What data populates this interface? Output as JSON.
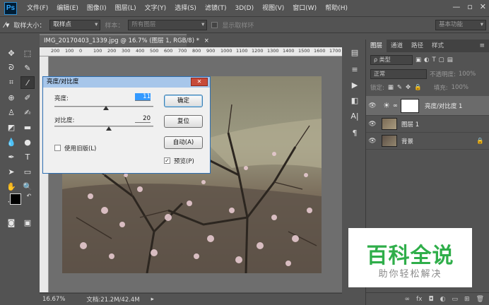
{
  "app": {
    "logo": "Ps"
  },
  "menu": [
    "文件(F)",
    "编辑(E)",
    "图像(I)",
    "图层(L)",
    "文字(Y)",
    "选择(S)",
    "滤镜(T)",
    "3D(D)",
    "视图(V)",
    "窗口(W)",
    "帮助(H)"
  ],
  "options_bar": {
    "sample_size_label": "取样大小：",
    "sample_size_value": "取样点",
    "sample_label": "样本：",
    "sample_value": "所有图层",
    "show_ring_label": "显示取样环",
    "workspace": "基本功能"
  },
  "document": {
    "tab_title": "IMG_20170403_1339.jpg @ 16.7% (图层 1, RGB/8) *",
    "ruler_ticks": [
      "200",
      "100",
      "0",
      "100",
      "200",
      "300",
      "400",
      "500",
      "600",
      "700",
      "800",
      "900",
      "1000",
      "1100",
      "1200",
      "1300",
      "1400",
      "1500",
      "1600",
      "1700"
    ],
    "zoom": "16.67%",
    "doc_size": "文档:21.2M/42.4M"
  },
  "dialog": {
    "title": "亮度/对比度",
    "brightness_label": "亮度:",
    "brightness_value": "11",
    "brightness_level": 0.52,
    "contrast_label": "对比度:",
    "contrast_value": "20",
    "contrast_level": 0.55,
    "legacy_label": "使用旧版(L)",
    "preview_label": "预览(P)",
    "preview_checked": "✓",
    "ok_label": "确定",
    "reset_label": "复位",
    "auto_label": "自动(A)"
  },
  "layers_panel": {
    "tabs": [
      "图层",
      "通道",
      "路径",
      "样式"
    ],
    "filter_kind": "ρ 类型",
    "blend_mode": "正常",
    "opacity_label": "不透明度:",
    "opacity_value": "100%",
    "lock_label": "锁定:",
    "fill_label": "填充:",
    "fill_value": "100%",
    "layers": [
      {
        "name": "亮度/对比度 1"
      },
      {
        "name": "图层 1"
      },
      {
        "name": "背景"
      }
    ]
  },
  "watermark": {
    "title": "百科全说",
    "subtitle": "助你轻松解决"
  },
  "colors": {
    "ui_bg": "#535353",
    "dialog_title": "#a7c6ea",
    "watermark_green": "#2fae4a",
    "selection": "#3399ff"
  }
}
